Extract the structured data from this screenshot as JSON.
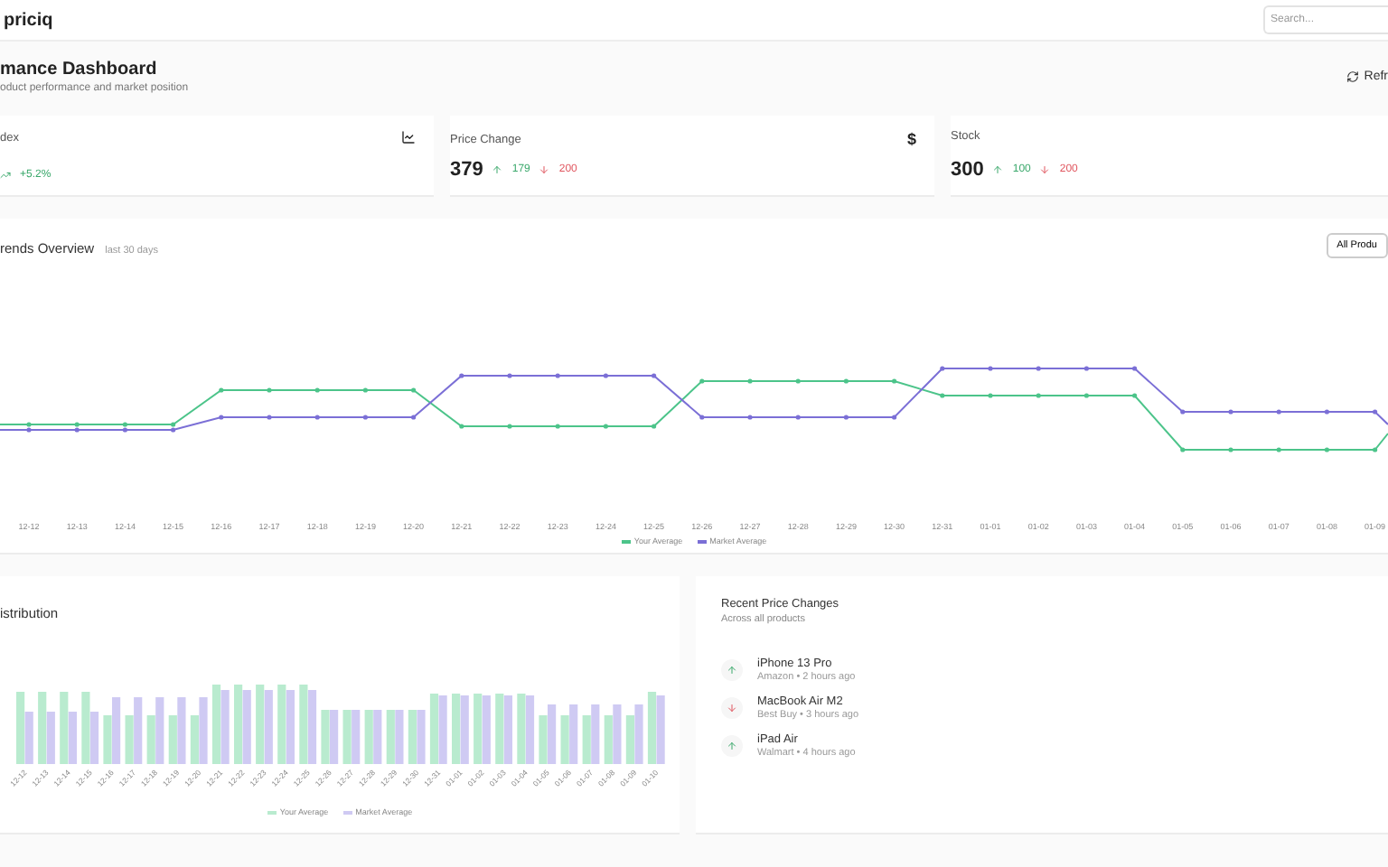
{
  "header": {
    "logo": "priciq",
    "search": {
      "placeholder": "Search..."
    }
  },
  "page": {
    "title": "mance Dashboard",
    "subtitle": "oduct performance and market position",
    "refresh": "Refr"
  },
  "stats": [
    {
      "kind": "index",
      "label": "dex",
      "change": "+5.2%"
    },
    {
      "kind": "price",
      "label": "Price Change",
      "symbol": "$",
      "value": "379",
      "up": "179",
      "down": "200"
    },
    {
      "kind": "stock",
      "label": "Stock",
      "value": "300",
      "up": "100",
      "down": "200"
    }
  ],
  "trends": {
    "title": "rends Overview",
    "period": "last 30 days",
    "filter": "All Produ",
    "x_labels": [
      "12-12",
      "12-13",
      "12-14",
      "12-15",
      "12-16",
      "12-17",
      "12-18",
      "12-19",
      "12-20",
      "12-21",
      "12-22",
      "12-23",
      "12-24",
      "12-25",
      "12-26",
      "12-27",
      "12-28",
      "12-29",
      "12-30",
      "12-31",
      "01-01",
      "01-02",
      "01-03",
      "01-04",
      "01-05",
      "01-06",
      "01-07",
      "01-08",
      "01-09"
    ],
    "legend": [
      {
        "name": "Your Average",
        "color": "#4cc48a"
      },
      {
        "name": "Market Average",
        "color": "#7b6fd6"
      }
    ]
  },
  "distribution": {
    "title": "istribution",
    "x_labels": [
      "12-12",
      "12-13",
      "12-14",
      "12-15",
      "12-16",
      "12-17",
      "12-18",
      "12-19",
      "12-20",
      "12-21",
      "12-22",
      "12-23",
      "12-24",
      "12-25",
      "12-26",
      "12-27",
      "12-28",
      "12-29",
      "12-30",
      "12-31",
      "01-01",
      "01-02",
      "01-03",
      "01-04",
      "01-05",
      "01-06",
      "01-07",
      "01-08",
      "01-09",
      "01-10"
    ],
    "legend": [
      {
        "name": "Your Average",
        "color": "#b9ebcf"
      },
      {
        "name": "Market Average",
        "color": "#cfcaf3"
      }
    ]
  },
  "recent": {
    "title": "Recent Price Changes",
    "subtitle": "Across all products",
    "items": [
      {
        "product": "iPhone 13 Pro",
        "meta": "Amazon • 2 hours ago",
        "kind": "increase"
      },
      {
        "product": "MacBook Air M2",
        "meta": "Best Buy • 3 hours ago",
        "kind": "decrease"
      },
      {
        "product": "iPad Air",
        "meta": "Walmart • 4 hours ago",
        "kind": "increase"
      }
    ]
  }
}
